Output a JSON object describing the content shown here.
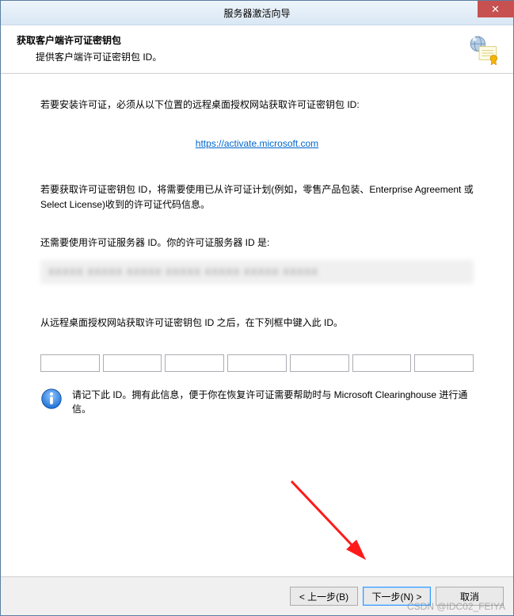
{
  "window": {
    "title": "服务器激活向导"
  },
  "header": {
    "title": "获取客户端许可证密钥包",
    "subtitle": "提供客户端许可证密钥包 ID。"
  },
  "body": {
    "install_notice": "若要安装许可证，必须从以下位置的远程桌面授权网站获取许可证密钥包 ID:",
    "link_text": "https://activate.microsoft.com",
    "acquire_notice": "若要获取许可证密钥包 ID，将需要使用已从许可证计划(例如，零售产品包装、Enterprise Agreement 或 Select License)收到的许可证代码信息。",
    "server_id_notice": "还需要使用许可证服务器 ID。你的许可证服务器 ID 是:",
    "server_id_value": "XXXXX  XXXXX  XXXXX  XXXXX  XXXXX  XXXXX  XXXXX",
    "after_notice": "从远程桌面授权网站获取许可证密钥包 ID 之后，在下列框中键入此 ID。",
    "info_text": "请记下此 ID。拥有此信息，便于你在恢复许可证需要帮助时与 Microsoft Clearinghouse 进行通信。"
  },
  "keypack_fields": [
    "",
    "",
    "",
    "",
    "",
    "",
    ""
  ],
  "footer": {
    "back": "< 上一步(B)",
    "next": "下一步(N) >",
    "cancel": "取消"
  },
  "watermark": "CSDN @IDC02_FEIYA"
}
